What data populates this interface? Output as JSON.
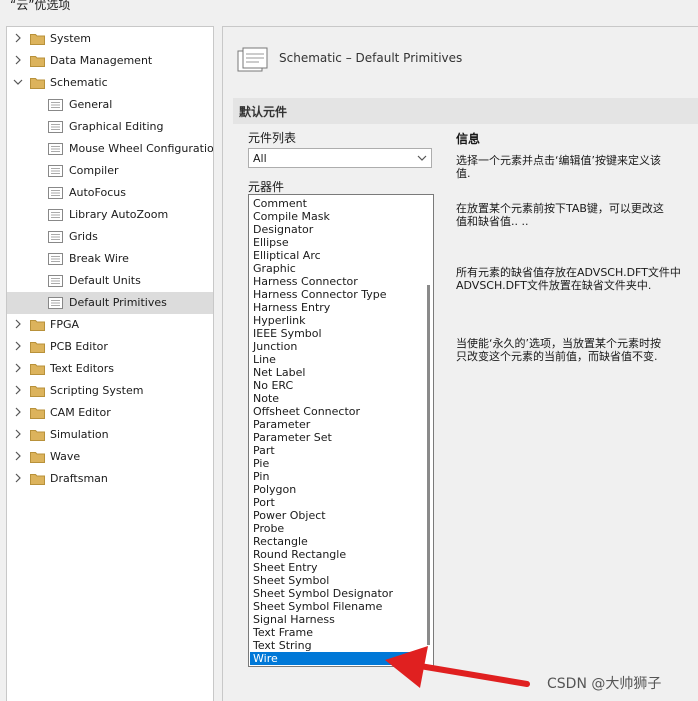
{
  "window": {
    "title": "“云”优选项"
  },
  "tree": {
    "items": [
      {
        "label": "System",
        "level": 0,
        "expanded": false,
        "selected": false
      },
      {
        "label": "Data Management",
        "level": 0,
        "expanded": false,
        "selected": false
      },
      {
        "label": "Schematic",
        "level": 0,
        "expanded": true,
        "selected": false
      },
      {
        "label": "General",
        "level": 1,
        "selected": false
      },
      {
        "label": "Graphical Editing",
        "level": 1,
        "selected": false
      },
      {
        "label": "Mouse Wheel Configuration",
        "level": 1,
        "selected": false
      },
      {
        "label": "Compiler",
        "level": 1,
        "selected": false
      },
      {
        "label": "AutoFocus",
        "level": 1,
        "selected": false
      },
      {
        "label": "Library AutoZoom",
        "level": 1,
        "selected": false
      },
      {
        "label": "Grids",
        "level": 1,
        "selected": false
      },
      {
        "label": "Break Wire",
        "level": 1,
        "selected": false
      },
      {
        "label": "Default Units",
        "level": 1,
        "selected": false
      },
      {
        "label": "Default Primitives",
        "level": 1,
        "selected": true
      },
      {
        "label": "FPGA",
        "level": 0,
        "expanded": false,
        "selected": false
      },
      {
        "label": "PCB Editor",
        "level": 0,
        "expanded": false,
        "selected": false
      },
      {
        "label": "Text Editors",
        "level": 0,
        "expanded": false,
        "selected": false
      },
      {
        "label": "Scripting System",
        "level": 0,
        "expanded": false,
        "selected": false
      },
      {
        "label": "CAM Editor",
        "level": 0,
        "expanded": false,
        "selected": false
      },
      {
        "label": "Simulation",
        "level": 0,
        "expanded": false,
        "selected": false
      },
      {
        "label": "Wave",
        "level": 0,
        "expanded": false,
        "selected": false
      },
      {
        "label": "Draftsman",
        "level": 0,
        "expanded": false,
        "selected": false
      }
    ]
  },
  "panel": {
    "header_title": "Schematic – Default Primitives",
    "section_title": "默认元件",
    "list_label": "元件列表",
    "list_combo_value": "All",
    "primitives_label": "元器件",
    "primitives": [
      "Comment",
      "Compile Mask",
      "Designator",
      "Ellipse",
      "Elliptical Arc",
      "Graphic",
      "Harness Connector",
      "Harness Connector Type",
      "Harness Entry",
      "Hyperlink",
      "IEEE Symbol",
      "Junction",
      "Line",
      "Net Label",
      "No ERC",
      "Note",
      "Offsheet Connector",
      "Parameter",
      "Parameter Set",
      "Part",
      "Pie",
      "Pin",
      "Polygon",
      "Port",
      "Power Object",
      "Probe",
      "Rectangle",
      "Round Rectangle",
      "Sheet Entry",
      "Sheet Symbol",
      "Sheet Symbol Designator",
      "Sheet Symbol Filename",
      "Signal Harness",
      "Text Frame",
      "Text String",
      "Wire"
    ],
    "selected_primitive": "Wire",
    "info_title": "信息",
    "info_lines": [
      "选择一个元素并点击‘编辑值’按键来定义该",
      "值.",
      "在放置某个元素前按下TAB键，可以更改这",
      "值和缺省值.. ..",
      "所有元素的缺省值存放在ADVSCH.DFT文件中",
      "ADVSCH.DFT文件放置在缺省文件夹中.",
      "当使能‘永久的’选项，当放置某个元素时按",
      "只改变这个元素的当前值，而缺省值不变."
    ]
  },
  "annotation": {
    "arrow_color": "#e02020"
  },
  "watermark": "CSDN @大帅狮子",
  "colors": {
    "selection": "#0078d7",
    "tree_selection": "#dcdcdc",
    "folder": "#dcb35c"
  }
}
